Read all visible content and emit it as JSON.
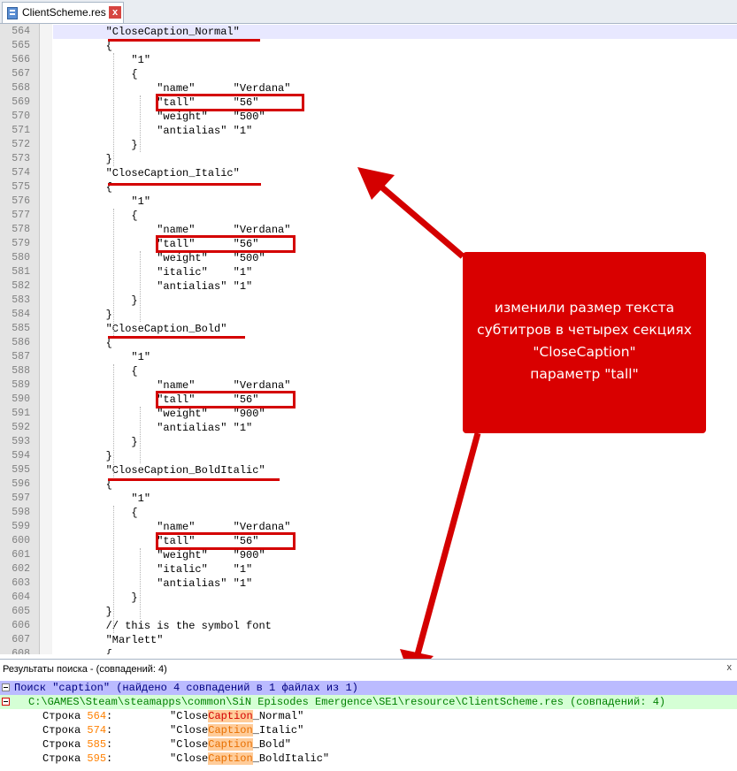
{
  "tab": {
    "title": "ClientScheme.res",
    "close": "x"
  },
  "editor": {
    "lines": [
      {
        "n": "564",
        "text": "        \"CloseCaption_Normal\""
      },
      {
        "n": "565",
        "text": "        {"
      },
      {
        "n": "566",
        "text": "            \"1\""
      },
      {
        "n": "567",
        "text": "            {"
      },
      {
        "n": "568",
        "text": "                \"name\"      \"Verdana\""
      },
      {
        "n": "569",
        "text": "                \"tall\"      \"56\""
      },
      {
        "n": "570",
        "text": "                \"weight\"    \"500\""
      },
      {
        "n": "571",
        "text": "                \"antialias\" \"1\""
      },
      {
        "n": "572",
        "text": "            }"
      },
      {
        "n": "573",
        "text": "        }"
      },
      {
        "n": "574",
        "text": "        \"CloseCaption_Italic\""
      },
      {
        "n": "575",
        "text": "        {"
      },
      {
        "n": "576",
        "text": "            \"1\""
      },
      {
        "n": "577",
        "text": "            {"
      },
      {
        "n": "578",
        "text": "                \"name\"      \"Verdana\""
      },
      {
        "n": "579",
        "text": "                \"tall\"      \"56\""
      },
      {
        "n": "580",
        "text": "                \"weight\"    \"500\""
      },
      {
        "n": "581",
        "text": "                \"italic\"    \"1\""
      },
      {
        "n": "582",
        "text": "                \"antialias\" \"1\""
      },
      {
        "n": "583",
        "text": "            }"
      },
      {
        "n": "584",
        "text": "        }"
      },
      {
        "n": "585",
        "text": "        \"CloseCaption_Bold\""
      },
      {
        "n": "586",
        "text": "        {"
      },
      {
        "n": "587",
        "text": "            \"1\""
      },
      {
        "n": "588",
        "text": "            {"
      },
      {
        "n": "589",
        "text": "                \"name\"      \"Verdana\""
      },
      {
        "n": "590",
        "text": "                \"tall\"      \"56\""
      },
      {
        "n": "591",
        "text": "                \"weight\"    \"900\""
      },
      {
        "n": "592",
        "text": "                \"antialias\" \"1\""
      },
      {
        "n": "593",
        "text": "            }"
      },
      {
        "n": "594",
        "text": "        }"
      },
      {
        "n": "595",
        "text": "        \"CloseCaption_BoldItalic\""
      },
      {
        "n": "596",
        "text": "        {"
      },
      {
        "n": "597",
        "text": "            \"1\""
      },
      {
        "n": "598",
        "text": "            {"
      },
      {
        "n": "599",
        "text": "                \"name\"      \"Verdana\""
      },
      {
        "n": "600",
        "text": "                \"tall\"      \"56\""
      },
      {
        "n": "601",
        "text": "                \"weight\"    \"900\""
      },
      {
        "n": "602",
        "text": "                \"italic\"    \"1\""
      },
      {
        "n": "603",
        "text": "                \"antialias\" \"1\""
      },
      {
        "n": "604",
        "text": "            }"
      },
      {
        "n": "605",
        "text": "        }"
      },
      {
        "n": "606",
        "text": "        // this is the symbol font"
      },
      {
        "n": "607",
        "text": "        \"Marlett\""
      },
      {
        "n": "608",
        "text": "        {"
      }
    ]
  },
  "callout": {
    "lines": [
      "изменили размер текста",
      "субтитров в четырех секциях",
      "\"CloseCaption\"",
      "параметр \"tall\""
    ],
    "color": "#d90000"
  },
  "results": {
    "title": "Результаты поиска - (совпадений: 4)",
    "close": "x",
    "header": "Поиск \"caption\" (найдено 4 совпадений в 1 файлах из 1)",
    "file": "C:\\GAMES\\Steam\\steamapps\\common\\SiN Episodes Emergence\\SE1\\resource\\ClientScheme.res (совпадений: 4)",
    "hits": [
      {
        "prefix": "Строка ",
        "num": "564",
        "sep": ":",
        "pre": "\"Close",
        "match": "Caption",
        "post": "_Normal\""
      },
      {
        "prefix": "Строка ",
        "num": "574",
        "sep": ":",
        "pre": "\"Close",
        "match": "Caption",
        "post": "_Italic\""
      },
      {
        "prefix": "Строка ",
        "num": "585",
        "sep": ":",
        "pre": "\"Close",
        "match": "Caption",
        "post": "_Bold\""
      },
      {
        "prefix": "Строка ",
        "num": "595",
        "sep": ":",
        "pre": "\"Close",
        "match": "Caption",
        "post": "_BoldItalic\""
      }
    ]
  },
  "colors": {
    "annotation_red": "#d40000",
    "header_bg": "#bbbbff",
    "file_bg": "#d5ffd5"
  }
}
